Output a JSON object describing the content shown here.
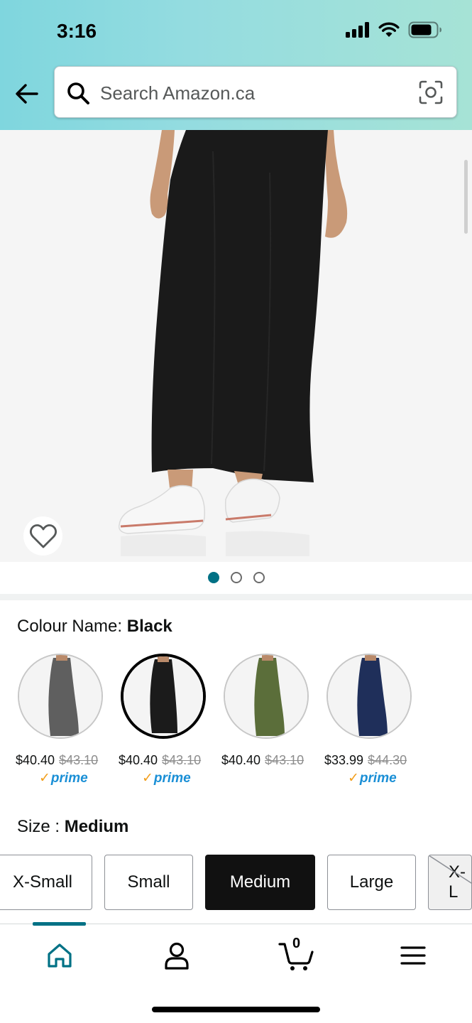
{
  "status_bar": {
    "time": "3:16"
  },
  "search": {
    "placeholder": "Search Amazon.ca"
  },
  "gallery": {
    "image_count": 3,
    "active_index": 0
  },
  "colour": {
    "label": "Colour Name:",
    "selected": "Black",
    "options": [
      {
        "price": "$40.40",
        "old_price": "$43.10",
        "prime": true,
        "color": "#5f5f5f"
      },
      {
        "price": "$40.40",
        "old_price": "$43.10",
        "prime": true,
        "color": "#1b1b1b"
      },
      {
        "price": "$40.40",
        "old_price": "$43.10",
        "prime": false,
        "color": "#5b6e3a"
      },
      {
        "price": "$33.99",
        "old_price": "$44.30",
        "prime": true,
        "color": "#1f2f5a"
      }
    ],
    "prime_label": "prime"
  },
  "size": {
    "label": "Size :",
    "selected": "Medium",
    "options": [
      "X-Small",
      "Small",
      "Medium",
      "Large",
      "X-L"
    ]
  },
  "bottom_nav": {
    "items": [
      "home-icon",
      "account-icon",
      "cart-icon",
      "menu-icon"
    ],
    "cart_count": "0"
  },
  "colors": {
    "accent": "#007185",
    "prime_blue": "#1a8fd6",
    "prime_check": "#f29e1b"
  }
}
